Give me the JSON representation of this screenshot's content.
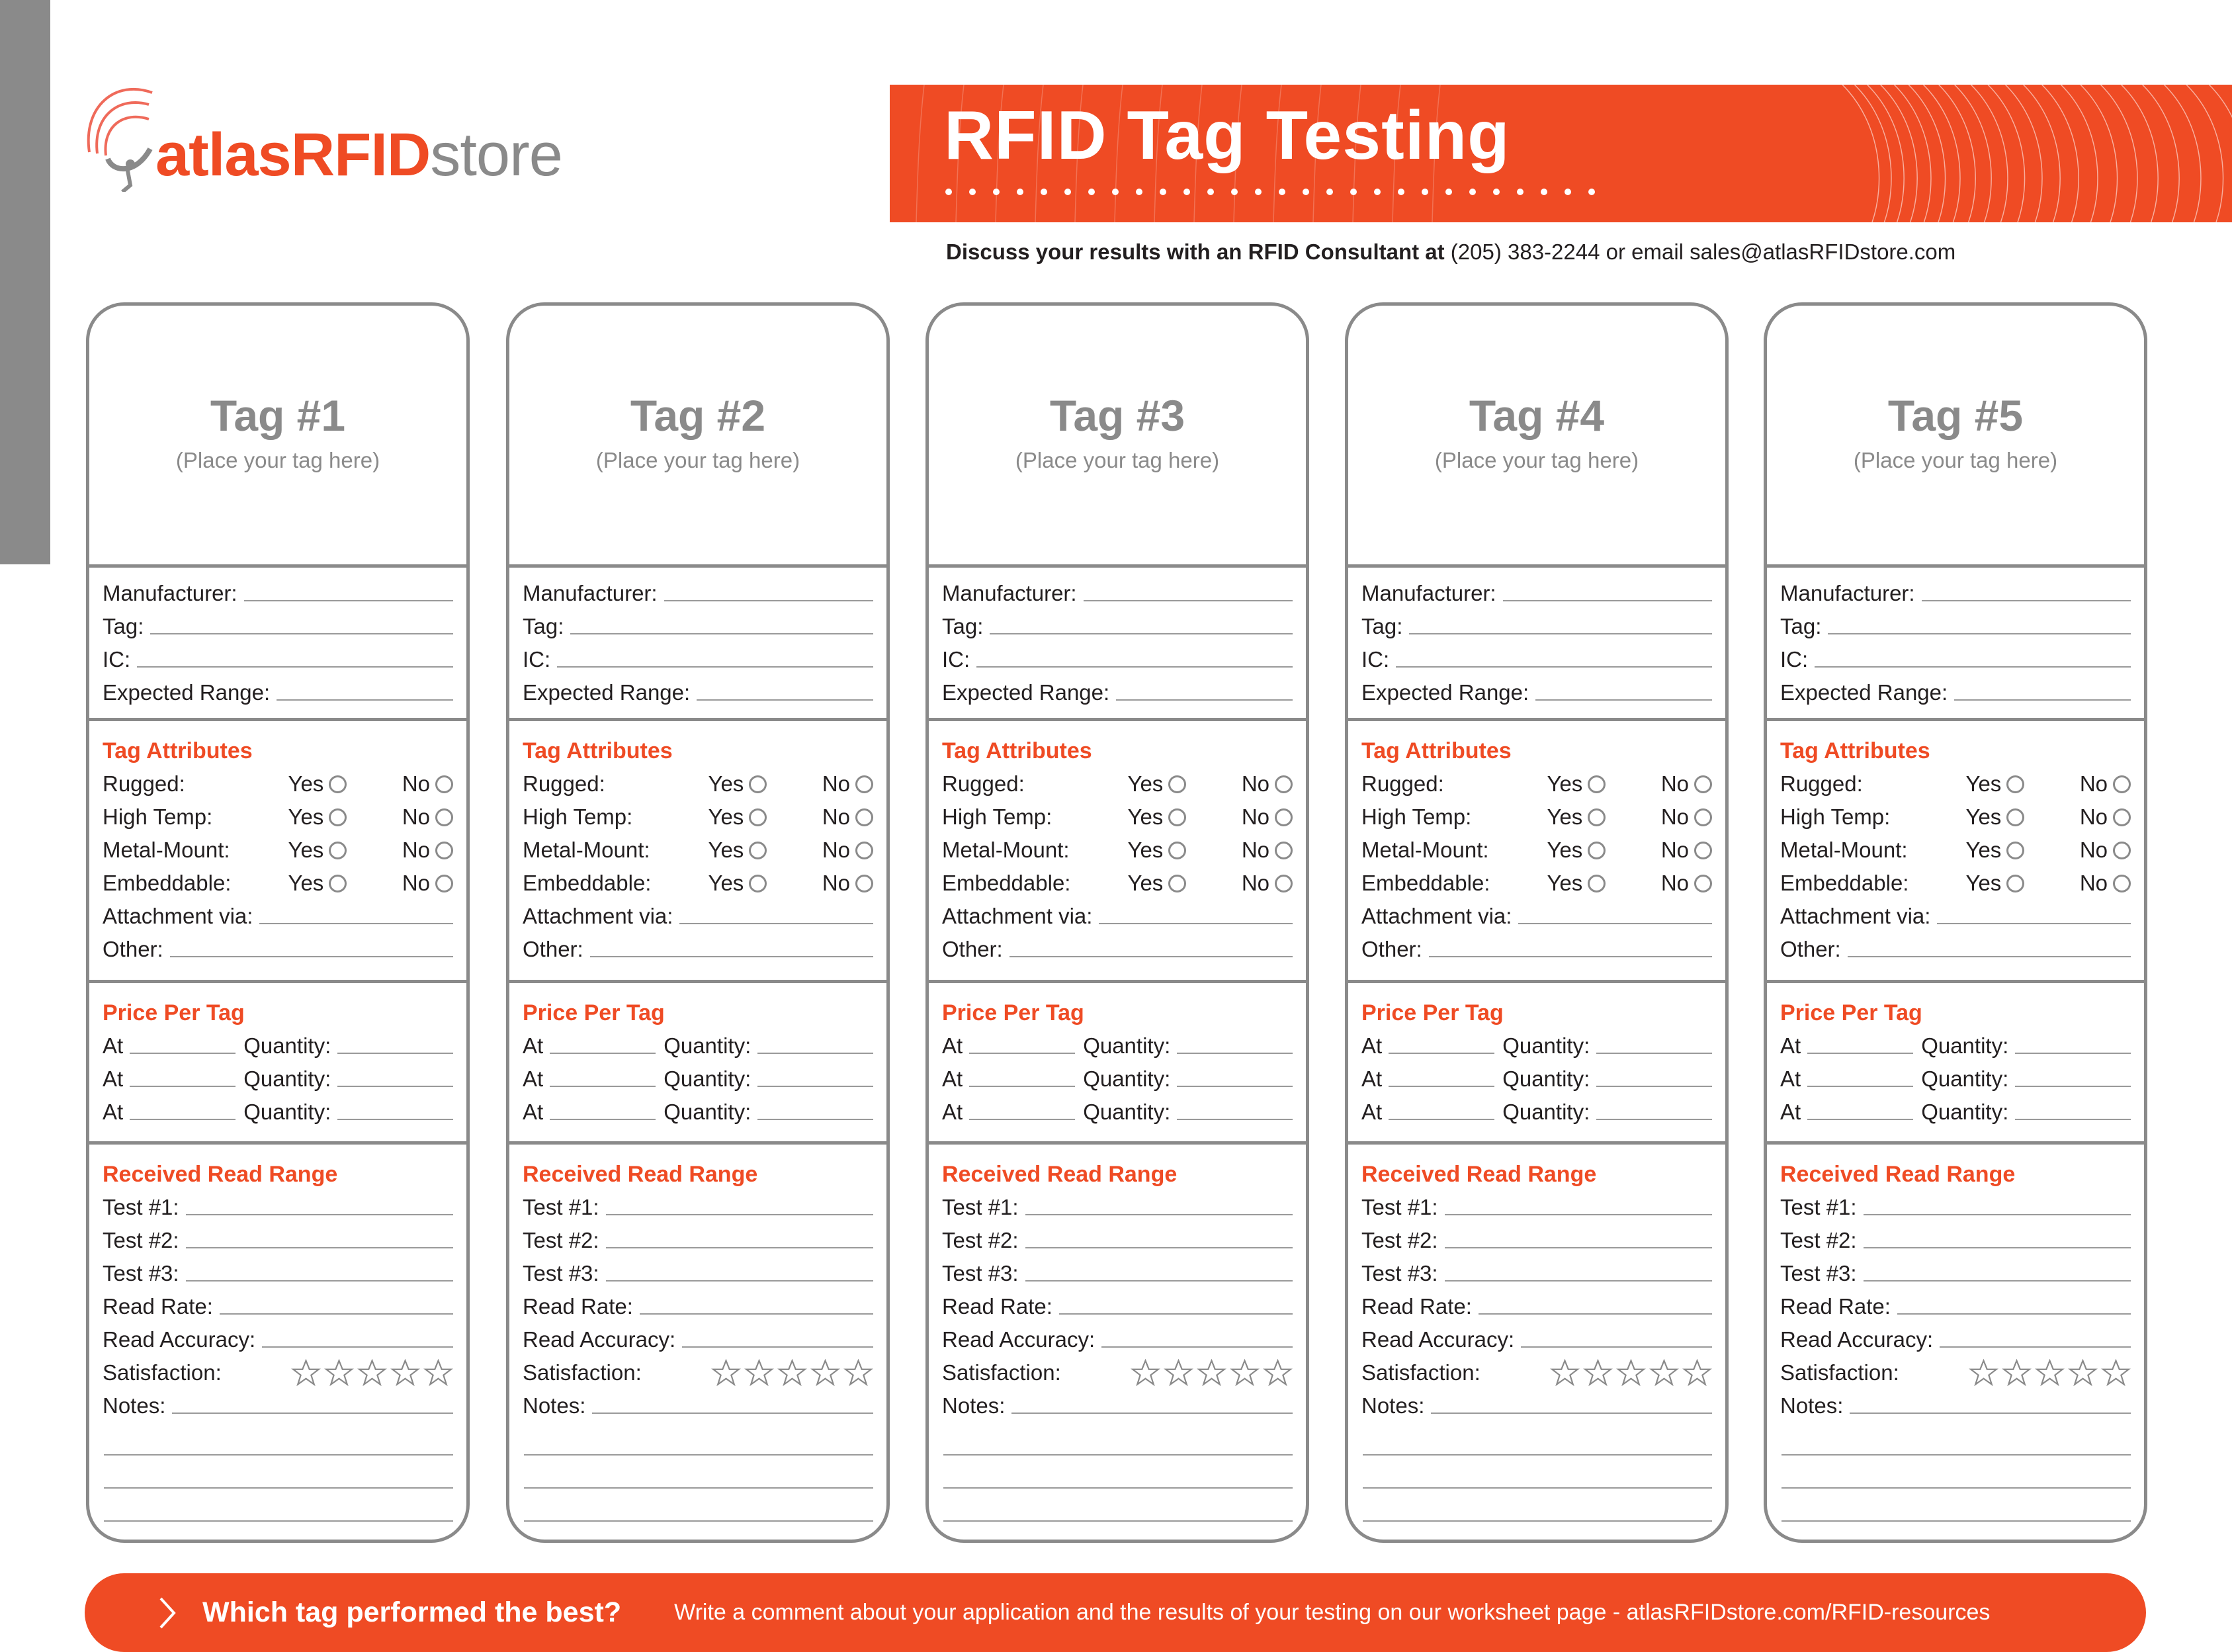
{
  "logo": {
    "brand": "atlasRFID",
    "suffix": "store"
  },
  "header": {
    "title": "RFID Tag Testing",
    "contact_bold": "Discuss your results with an RFID Consultant at",
    "contact_rest": " (205) 383-2244 or email sales@atlasRFIDstore.com"
  },
  "colors": {
    "accent": "#ef4b24",
    "gray": "#8a8a8a",
    "text": "#231f20"
  },
  "cards": [
    {
      "title": "Tag #1",
      "subtitle": "(Place your tag here)"
    },
    {
      "title": "Tag #2",
      "subtitle": "(Place your tag here)"
    },
    {
      "title": "Tag #3",
      "subtitle": "(Place your tag here)"
    },
    {
      "title": "Tag #4",
      "subtitle": "(Place your tag here)"
    },
    {
      "title": "Tag #5",
      "subtitle": "(Place your tag here)"
    }
  ],
  "form": {
    "info_fields": [
      "Manufacturer:",
      "Tag:",
      "IC:",
      "Expected Range:"
    ],
    "attributes_title": "Tag Attributes",
    "attributes": [
      "Rugged:",
      "High Temp:",
      "Metal-Mount:",
      "Embeddable:"
    ],
    "yes_label": "Yes",
    "no_label": "No",
    "attachment_label": "Attachment via:",
    "other_label": "Other:",
    "price_title": "Price Per Tag",
    "price_at_label": "At",
    "price_qty_label": "Quantity:",
    "price_rows": 3,
    "read_title": "Received Read Range",
    "read_fields": [
      "Test #1:",
      "Test #2:",
      "Test #3:",
      "Read Rate:",
      "Read Accuracy:"
    ],
    "satisfaction_label": "Satisfaction:",
    "satisfaction_stars": 5,
    "satisfaction_value": 0,
    "notes_label": "Notes:"
  },
  "footer": {
    "icon": "chevron-right-icon",
    "question": "Which tag performed the best?",
    "text": "Write a comment about your application and the results of your testing on our worksheet page - atlasRFIDstore.com/RFID-resources"
  }
}
